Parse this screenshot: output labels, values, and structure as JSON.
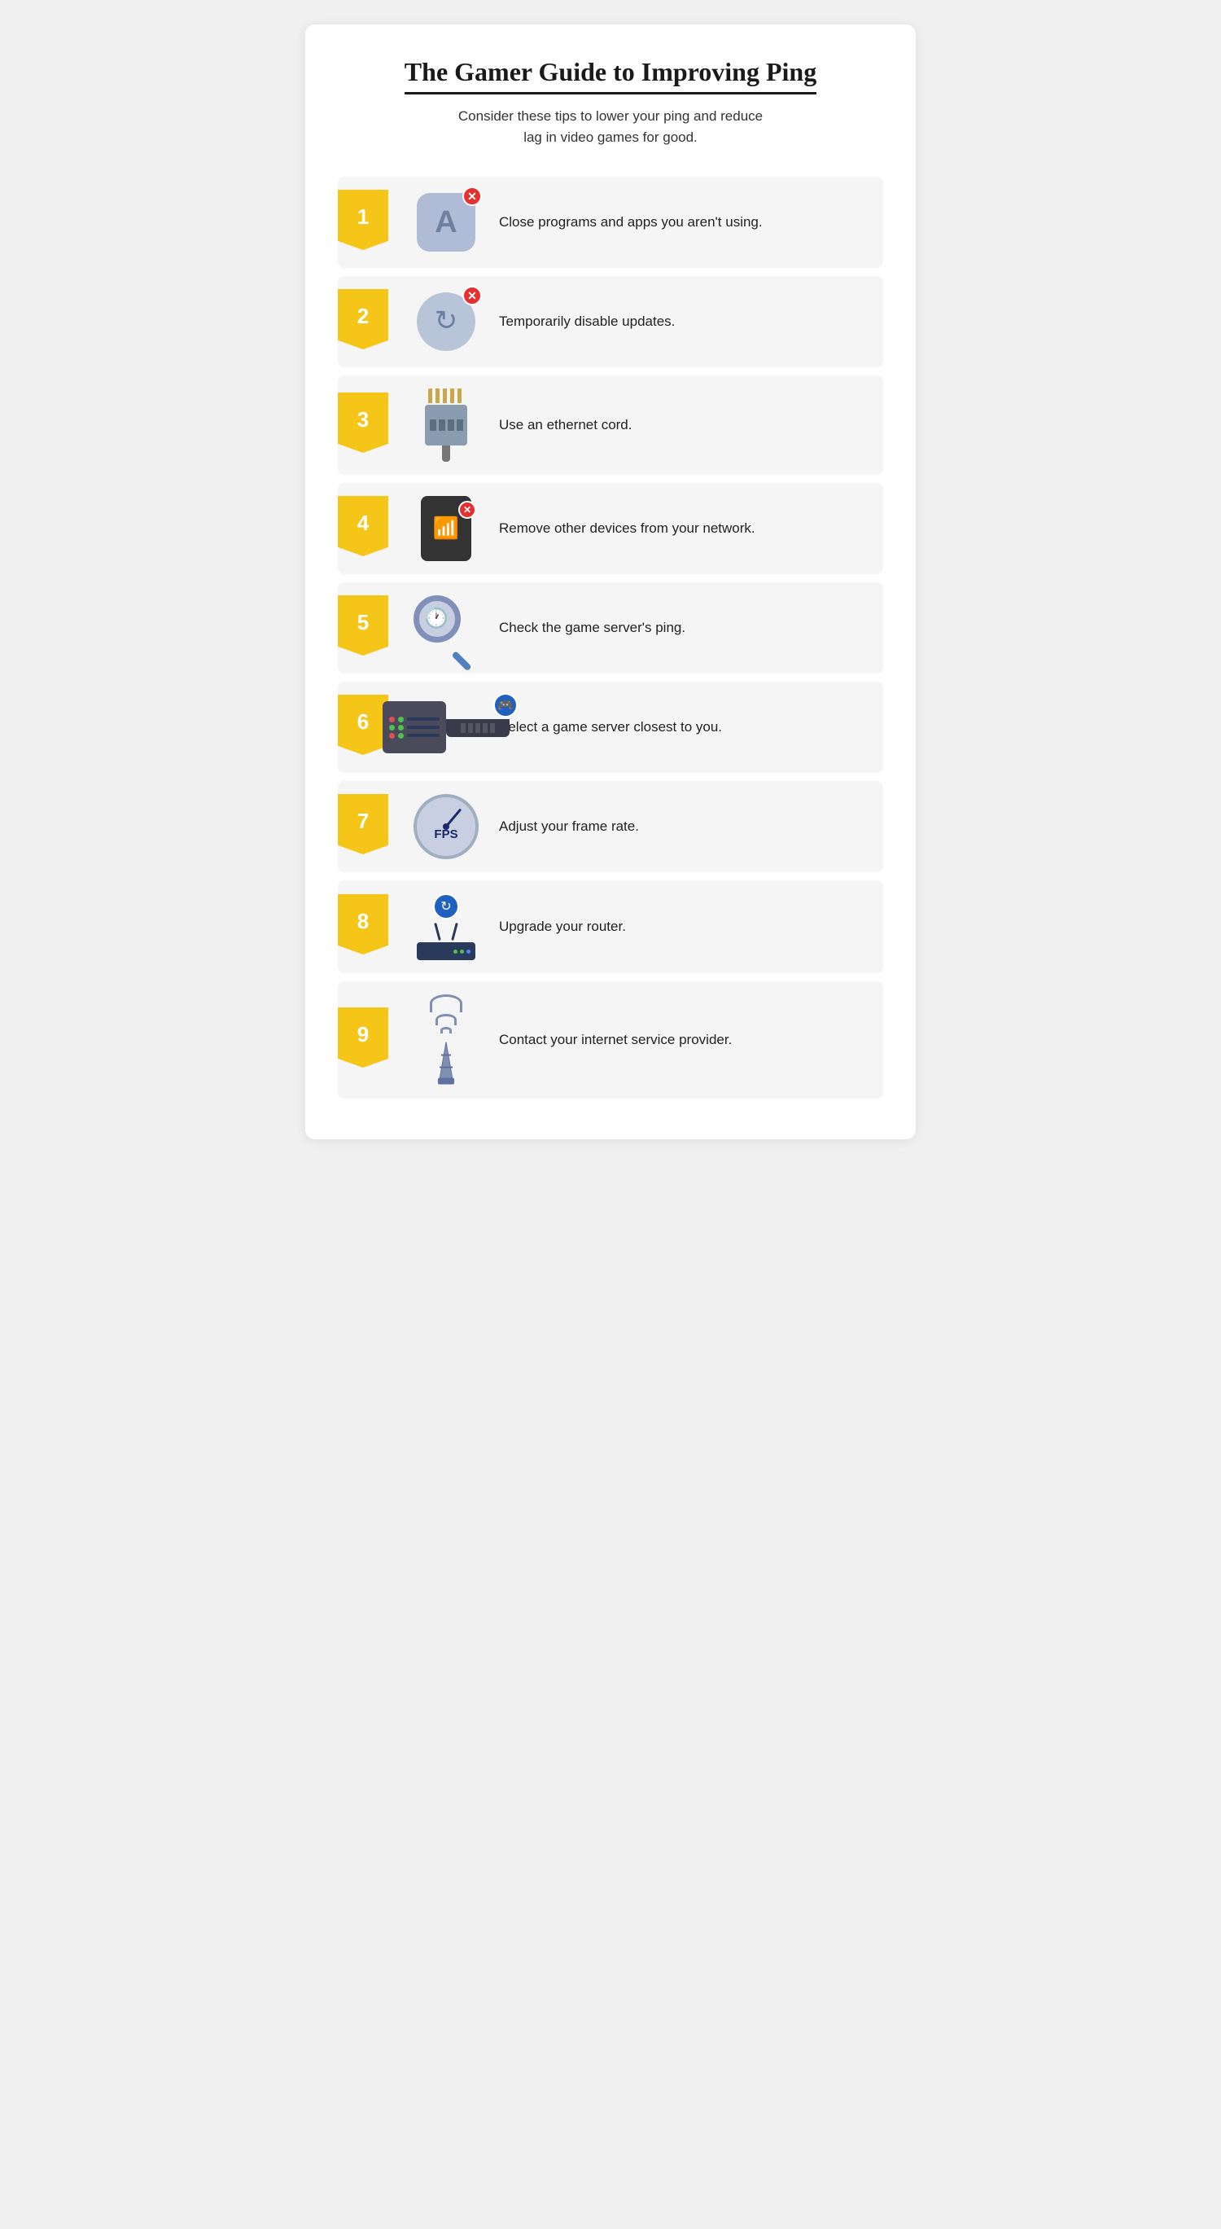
{
  "page": {
    "title": "The Gamer Guide to Improving Ping",
    "subtitle": "Consider these tips to lower your ping and reduce\nlag in video games for good.",
    "tips": [
      {
        "number": "1",
        "text": "Close programs and apps you aren't using.",
        "icon_type": "app_close"
      },
      {
        "number": "2",
        "text": "Temporarily disable updates.",
        "icon_type": "update_disable"
      },
      {
        "number": "3",
        "text": "Use an ethernet cord.",
        "icon_type": "ethernet"
      },
      {
        "number": "4",
        "text": "Remove other devices from your network.",
        "icon_type": "device_remove"
      },
      {
        "number": "5",
        "text": "Check the game server's ping.",
        "icon_type": "ping_check"
      },
      {
        "number": "6",
        "text": "Select a game server closest to you.",
        "icon_type": "server_select"
      },
      {
        "number": "7",
        "text": "Adjust your frame rate.",
        "icon_type": "frame_rate"
      },
      {
        "number": "8",
        "text": "Upgrade your router.",
        "icon_type": "router_upgrade"
      },
      {
        "number": "9",
        "text": "Contact your internet service provider.",
        "icon_type": "isp_contact"
      }
    ],
    "colors": {
      "flag_yellow": "#f5c518",
      "background": "#f0f0f0",
      "card_bg": "#ffffff",
      "tip_bg": "#f5f5f5",
      "red_badge": "#e53030",
      "blue_badge": "#2060c0"
    }
  }
}
